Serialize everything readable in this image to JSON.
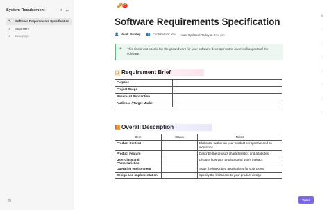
{
  "sidebar": {
    "title": "System Requirement",
    "items": [
      {
        "label": "Software Requirements Specification",
        "icon": "document-icon"
      },
      {
        "label": "Start Here",
        "icon": "rocket-icon"
      },
      {
        "label": "New page",
        "icon": "plus-icon"
      }
    ]
  },
  "page": {
    "cover_emoji": "🥜🍅",
    "title": "Software Requirements Specification",
    "meta": {
      "author": "Vivek Pandey",
      "contributors_label": "Contributors:",
      "contributors_value": "You",
      "updated": "Last Updated: Today at 9:54 pm"
    },
    "callout": "This document should lay the groundwork for your software development to review all aspects of the software.",
    "brief": {
      "heading": "Requirement Brief",
      "rows": [
        "Purpose",
        "Project Scope",
        "Document Convention",
        "Audience / Target Market"
      ]
    },
    "overall": {
      "heading": "Overall Description",
      "headers": [
        "Item",
        "Status",
        "Notes"
      ],
      "rows": [
        {
          "item": "Product Context",
          "status": "",
          "notes": "Elaborate further on your product perspective and its inclusions."
        },
        {
          "item": "Product Feature",
          "status": "",
          "notes": "Describe the product characteristics and attributes."
        },
        {
          "item": "User Class and Characteristics",
          "status": "",
          "notes": "Discuss how your products and users interact."
        },
        {
          "item": "Operating environment",
          "status": "",
          "notes": "State the integrated applications for your users."
        },
        {
          "item": "Design and implementation",
          "status": "",
          "notes": "Specify the limitations to your product design."
        }
      ]
    }
  },
  "task_button": "Tasks",
  "colors": {
    "accent": "#7b68ee",
    "callout_bg": "#eef6f1",
    "brief_highlight": "#fbe4ec",
    "overall_highlight": "#e6e6fa"
  }
}
